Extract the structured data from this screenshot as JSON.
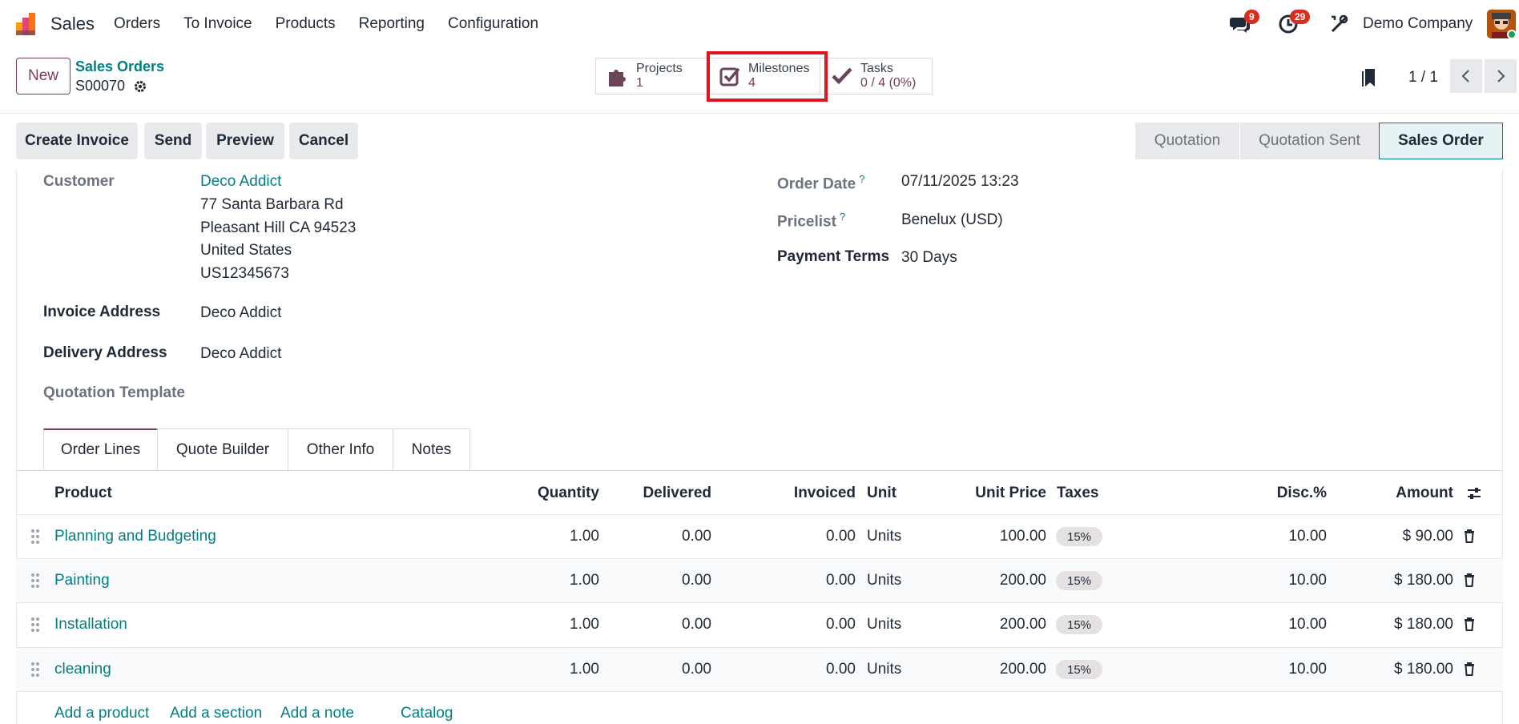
{
  "navbar": {
    "app_name": "Sales",
    "menu": [
      "Orders",
      "To Invoice",
      "Products",
      "Reporting",
      "Configuration"
    ],
    "messages_count": "9",
    "activities_count": "29",
    "company": "Demo Company"
  },
  "control_panel": {
    "new_label": "New",
    "breadcrumb": "Sales Orders",
    "record_name": "S00070",
    "pager": "1 / 1"
  },
  "smart_buttons": [
    {
      "label": "Projects",
      "value": "1"
    },
    {
      "label": "Milestones",
      "value": "4"
    },
    {
      "label": "Tasks",
      "value": "0 / 4 (0%)"
    }
  ],
  "actions": [
    "Create Invoice",
    "Send",
    "Preview",
    "Cancel"
  ],
  "status": {
    "stages": [
      "Quotation",
      "Quotation Sent",
      "Sales Order"
    ],
    "active": "Sales Order"
  },
  "form": {
    "customer_label": "Customer",
    "customer_name": "Deco Addict",
    "address_lines": [
      "77 Santa Barbara Rd",
      "Pleasant Hill CA 94523",
      "United States",
      "US12345673"
    ],
    "invoice_address_label": "Invoice Address",
    "invoice_address": "Deco Addict",
    "delivery_address_label": "Delivery Address",
    "delivery_address": "Deco Addict",
    "quotation_template_label": "Quotation Template",
    "order_date_label": "Order Date",
    "order_date": "07/11/2025 13:23",
    "pricelist_label": "Pricelist",
    "pricelist": "Benelux (USD)",
    "payment_terms_label": "Payment Terms",
    "payment_terms": "30 Days",
    "help_mark": "?"
  },
  "tabs": [
    "Order Lines",
    "Quote Builder",
    "Other Info",
    "Notes"
  ],
  "table": {
    "headers": {
      "product": "Product",
      "quantity": "Quantity",
      "delivered": "Delivered",
      "invoiced": "Invoiced",
      "unit": "Unit",
      "unit_price": "Unit Price",
      "taxes": "Taxes",
      "disc": "Disc.%",
      "amount": "Amount"
    },
    "rows": [
      {
        "product": "Planning and Budgeting",
        "quantity": "1.00",
        "delivered": "0.00",
        "invoiced": "0.00",
        "unit": "Units",
        "unit_price": "100.00",
        "tax": "15%",
        "disc": "10.00",
        "amount": "$ 90.00"
      },
      {
        "product": "Painting",
        "quantity": "1.00",
        "delivered": "0.00",
        "invoiced": "0.00",
        "unit": "Units",
        "unit_price": "200.00",
        "tax": "15%",
        "disc": "10.00",
        "amount": "$ 180.00"
      },
      {
        "product": "Installation",
        "quantity": "1.00",
        "delivered": "0.00",
        "invoiced": "0.00",
        "unit": "Units",
        "unit_price": "200.00",
        "tax": "15%",
        "disc": "10.00",
        "amount": "$ 180.00"
      },
      {
        "product": "cleaning",
        "quantity": "1.00",
        "delivered": "0.00",
        "invoiced": "0.00",
        "unit": "Units",
        "unit_price": "200.00",
        "tax": "15%",
        "disc": "10.00",
        "amount": "$ 180.00"
      }
    ],
    "add_links": [
      "Add a product",
      "Add a section",
      "Add a note",
      "Catalog"
    ]
  },
  "colors": {
    "brand": "#7c3c5a",
    "link": "#017e84",
    "highlight": "#e3131b",
    "badge": "#d92d20"
  }
}
